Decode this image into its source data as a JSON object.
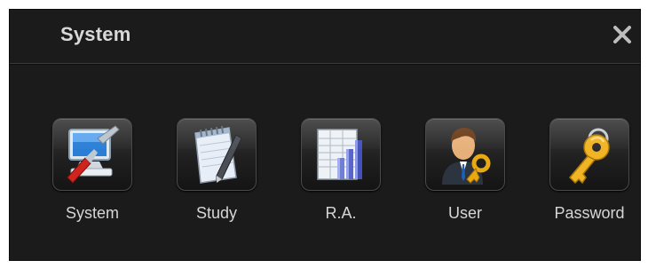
{
  "window": {
    "title": "System",
    "close_icon": "close-icon"
  },
  "items": [
    {
      "label": "System",
      "icon": "computer-tools-icon"
    },
    {
      "label": "Study",
      "icon": "notepad-pen-icon"
    },
    {
      "label": "R.A.",
      "icon": "report-chart-icon"
    },
    {
      "label": "User",
      "icon": "user-key-icon"
    },
    {
      "label": "Password",
      "icon": "key-icon"
    }
  ],
  "colors": {
    "background": "#1b1b1b",
    "title_text": "#d9d9d9",
    "label_text": "#d6d6d6",
    "key_gold": "#e8a912"
  }
}
